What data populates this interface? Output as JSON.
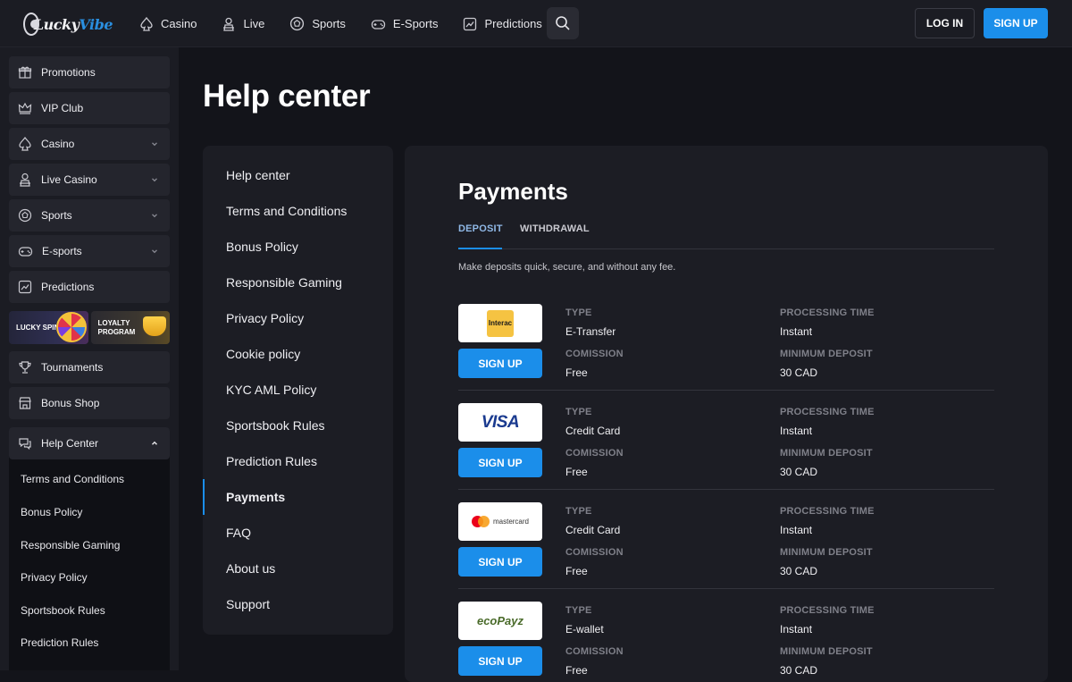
{
  "brand": {
    "logo_text_a": "Lucky",
    "logo_text_b": "Vibe"
  },
  "topnav": [
    {
      "label": "Casino",
      "icon": "spade-icon"
    },
    {
      "label": "Live",
      "icon": "dealer-icon"
    },
    {
      "label": "Sports",
      "icon": "soccer-ball-icon"
    },
    {
      "label": "E-Sports",
      "icon": "gamepad-icon"
    },
    {
      "label": "Predictions",
      "icon": "chart-icon"
    }
  ],
  "header": {
    "login_label": "LOG IN",
    "signup_label": "SIGN UP"
  },
  "sidebar": {
    "items": [
      {
        "label": "Promotions",
        "icon": "gift-icon"
      },
      {
        "label": "VIP Club",
        "icon": "crown-icon"
      },
      {
        "label": "Casino",
        "icon": "spade-icon"
      },
      {
        "label": "Live Casino",
        "icon": "dealer-icon"
      },
      {
        "label": "Sports",
        "icon": "soccer-ball-icon"
      },
      {
        "label": "E-sports",
        "icon": "gamepad-icon"
      },
      {
        "label": "Predictions",
        "icon": "chart-icon"
      }
    ],
    "promos": [
      {
        "label_line1": "LUCKY SPIN",
        "label_line2": ""
      },
      {
        "label_line1": "LOYALTY",
        "label_line2": "PROGRAM"
      }
    ],
    "items2": [
      {
        "label": "Tournaments",
        "icon": "trophy-icon"
      },
      {
        "label": "Bonus Shop",
        "icon": "shop-icon"
      }
    ],
    "help": {
      "label": "Help Center",
      "icon": "chat-icon",
      "children": [
        "Terms and Conditions",
        "Bonus Policy",
        "Responsible Gaming",
        "Privacy Policy",
        "Sportsbook Rules",
        "Prediction Rules"
      ]
    }
  },
  "main": {
    "title": "Help center",
    "help_nav": [
      "Help center",
      "Terms and Conditions",
      "Bonus Policy",
      "Responsible Gaming",
      "Privacy Policy",
      "Cookie policy",
      "KYC AML Policy",
      "Sportsbook Rules",
      "Prediction Rules",
      "Payments",
      "FAQ",
      "About us",
      "Support"
    ],
    "active_nav": "Payments"
  },
  "payments": {
    "title": "Payments",
    "tabs": [
      "DEPOSIT",
      "WITHDRAWAL"
    ],
    "active_tab": "DEPOSIT",
    "description": "Make deposits quick, secure, and without any fee.",
    "labels": {
      "type": "TYPE",
      "processing": "PROCESSING TIME",
      "commission": "COMISSION",
      "minimum": "MINIMUM DEPOSIT",
      "signup": "SIGN UP"
    },
    "methods": [
      {
        "logo": "interac-logo",
        "logo_text": "Interac",
        "type": "E-Transfer",
        "processing": "Instant",
        "commission": "Free",
        "minimum": "30 CAD"
      },
      {
        "logo": "visa-logo",
        "logo_text": "VISA",
        "type": "Credit Card",
        "processing": "Instant",
        "commission": "Free",
        "minimum": "30 CAD"
      },
      {
        "logo": "mastercard-logo",
        "logo_text": "mastercard",
        "type": "Credit Card",
        "processing": "Instant",
        "commission": "Free",
        "minimum": "30 CAD"
      },
      {
        "logo": "ecopayz-logo",
        "logo_text": "ecoPayz",
        "type": "E-wallet",
        "processing": "Instant",
        "commission": "Free",
        "minimum": "30 CAD"
      }
    ]
  },
  "colors": {
    "accent": "#1b8eea",
    "background": "#13141a",
    "panel": "#1c1d24",
    "sidebar_item": "#24252d"
  }
}
